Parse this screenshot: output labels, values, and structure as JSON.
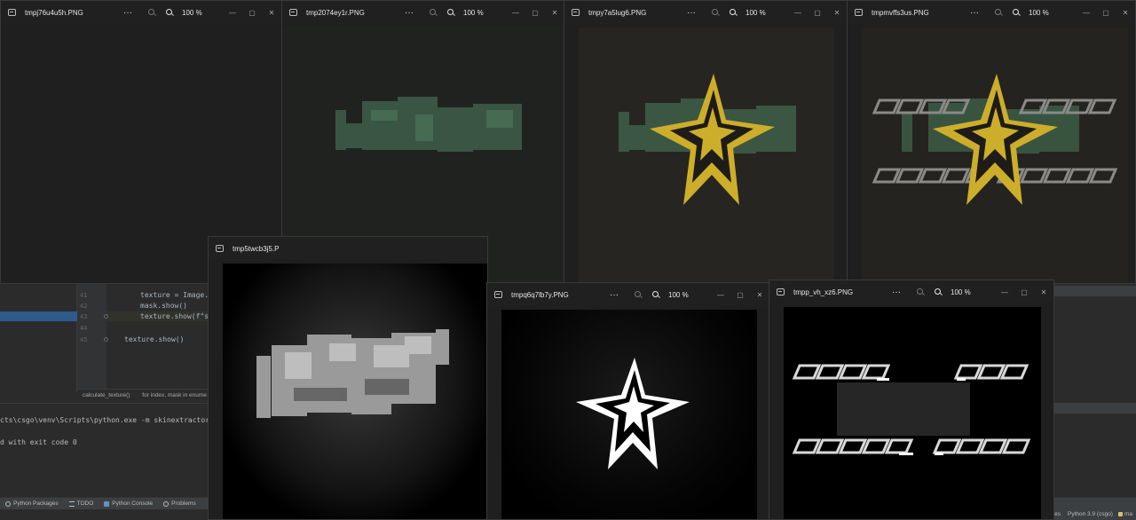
{
  "ide": {
    "line_numbers": [
      "41",
      "42",
      "43",
      "44",
      "45"
    ],
    "code_lines": [
      "texture = Image.c",
      "mask.show()",
      "texture.show(f\"st",
      "",
      "texture.show()"
    ],
    "breadcrumb": [
      "calculate_texture()",
      "for index, mask in enume"
    ],
    "terminal": [
      "cts\\csgo\\venv\\Scripts\\python.exe -m skinextractor \"--",
      "",
      "d with exit code 0"
    ],
    "tool_windows": [
      "Python Packages",
      "TODO",
      "Python Console",
      "Problems"
    ],
    "status_interpreter": "Python 3.9 (csgo)",
    "status_trailing": "ma",
    "status_left": "es"
  },
  "windows": [
    {
      "title": "tmpj76u4u5h.PNG",
      "zoom": "100 %"
    },
    {
      "title": "tmp2074ey1r.PNG",
      "zoom": "100 %"
    },
    {
      "title": "tmpy7a5lug6.PNG",
      "zoom": "100 %"
    },
    {
      "title": "tmpmvffs3us.PNG",
      "zoom": "100 %"
    },
    {
      "title": "tmp5twcb3j5.P",
      "zoom": ""
    },
    {
      "title": "tmpq6q7lb7y.PNG",
      "zoom": "100 %"
    },
    {
      "title": "tmpp_vh_xz6.PNG",
      "zoom": "100 %"
    }
  ],
  "controls": {
    "more": "···",
    "minimize": "—",
    "maximize": "▢",
    "close": "✕"
  },
  "colors": {
    "star_gold": "#cdae2a",
    "green_texture": "#4e7a5e",
    "mask_white": "#ffffff"
  }
}
